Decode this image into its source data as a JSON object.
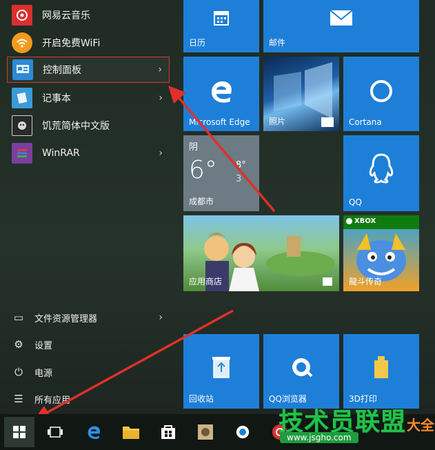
{
  "apps": [
    {
      "label": "网易云音乐",
      "icon": "netease-music-icon",
      "color": "#d8302f"
    },
    {
      "label": "开启免费WiFi",
      "icon": "wifi-icon",
      "color": "#f29b1d"
    },
    {
      "label": "控制面板",
      "icon": "control-panel-icon",
      "color": "#2e8ad6",
      "chevron": "›"
    },
    {
      "label": "记事本",
      "icon": "notepad-icon",
      "color": "#3a9bd9",
      "chevron": "›"
    },
    {
      "label": "饥荒简体中文版",
      "icon": "dont-starve-icon",
      "color": "#cfcfcf"
    },
    {
      "label": "WinRAR",
      "icon": "winrar-icon",
      "color": "#7b3f9e",
      "chevron": "›"
    }
  ],
  "system": [
    {
      "label": "文件资源管理器",
      "icon": "file-explorer-icon",
      "glyph": "▭",
      "chevron": "›"
    },
    {
      "label": "设置",
      "icon": "gear-icon",
      "glyph": "⚙"
    },
    {
      "label": "电源",
      "icon": "power-icon",
      "glyph": "⏻"
    },
    {
      "label": "所有应用",
      "icon": "all-apps-icon",
      "glyph": "☰"
    }
  ],
  "tiles": {
    "calendar": "日历",
    "mail": "邮件",
    "edge": "Microsoft Edge",
    "photos": "照片",
    "cortana": "Cortana",
    "weather": {
      "condition": "阴",
      "temp": "6°",
      "high": "8°",
      "low": "3",
      "city": "成都市"
    },
    "qq": "QQ",
    "store": "应用商店",
    "xbox_badge": "XBOX",
    "game": "龍斗传奇",
    "recycle": "回收站",
    "qq_browser": "QQ浏览器",
    "builder": "3D打印"
  },
  "watermark": {
    "brand": "技术员联盟",
    "url": "www.jsgho.com",
    "suffix": "大全"
  },
  "colors": {
    "tile_blue": "#1e7fd8",
    "arrow_red": "#e0302a",
    "highlight_border": "#d23a2a"
  }
}
